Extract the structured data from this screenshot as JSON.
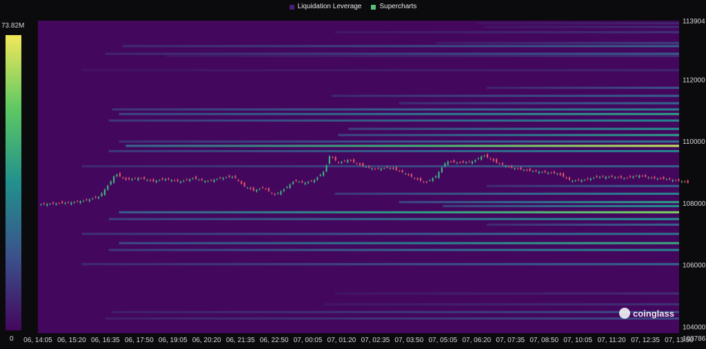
{
  "legend": {
    "items": [
      {
        "label": "Liquidation Leverage",
        "color": "#4a1f7a"
      },
      {
        "label": "Supercharts",
        "color": "#56c17a"
      }
    ]
  },
  "colorbar": {
    "max_label": "73.82M",
    "min_label": "0"
  },
  "watermark": "coinglass",
  "chart_data": {
    "type": "heatmap",
    "title": "",
    "xlabel": "",
    "ylabel": "",
    "ylim": [
      103786,
      113904
    ],
    "x_ticks": [
      "06, 14:05",
      "06, 15:20",
      "06, 16:35",
      "06, 17:50",
      "06, 19:05",
      "06, 20:20",
      "06, 21:35",
      "06, 22:50",
      "07, 00:05",
      "07, 01:20",
      "07, 02:35",
      "07, 03:50",
      "07, 05:05",
      "07, 06:20",
      "07, 07:35",
      "07, 08:50",
      "07, 10:05",
      "07, 11:20",
      "07, 12:35",
      "07, 13:50"
    ],
    "y_ticks": [
      113904,
      112000,
      110000,
      108000,
      106000,
      104000,
      103786
    ],
    "colorscale": {
      "min": 0,
      "max": 73.82,
      "unit": "M",
      "colors": [
        "#44075e",
        "#3b528b",
        "#21908d",
        "#5dc863",
        "#f2e85a"
      ]
    },
    "background_color": "#44075e",
    "liquidation_levels": [
      {
        "price": 113820,
        "start": 13.0,
        "intensity": 0.1
      },
      {
        "price": 113700,
        "start": 13.2,
        "intensity": 0.12
      },
      {
        "price": 113530,
        "start": 8.8,
        "intensity": 0.14
      },
      {
        "price": 113180,
        "start": 11.8,
        "intensity": 0.18
      },
      {
        "price": 113080,
        "start": 2.5,
        "intensity": 0.3
      },
      {
        "price": 112830,
        "start": 2.0,
        "intensity": 0.28
      },
      {
        "price": 112760,
        "start": 3.8,
        "intensity": 0.12
      },
      {
        "price": 112300,
        "start": 1.3,
        "intensity": 0.1
      },
      {
        "price": 111730,
        "start": 13.3,
        "intensity": 0.25
      },
      {
        "price": 111470,
        "start": 8.7,
        "intensity": 0.3
      },
      {
        "price": 111230,
        "start": 10.7,
        "intensity": 0.32
      },
      {
        "price": 111030,
        "start": 2.2,
        "intensity": 0.42
      },
      {
        "price": 110880,
        "start": 2.4,
        "intensity": 0.55
      },
      {
        "price": 110670,
        "start": 2.1,
        "intensity": 0.45
      },
      {
        "price": 110400,
        "start": 9.2,
        "intensity": 0.5
      },
      {
        "price": 110200,
        "start": 8.9,
        "intensity": 0.55
      },
      {
        "price": 109990,
        "start": 2.4,
        "intensity": 0.38
      },
      {
        "price": 109850,
        "start": 2.6,
        "intensity": 0.92
      },
      {
        "price": 109680,
        "start": 2.1,
        "intensity": 0.45
      },
      {
        "price": 109190,
        "start": 1.3,
        "intensity": 0.3
      },
      {
        "price": 108550,
        "start": 13.3,
        "intensity": 0.32
      },
      {
        "price": 108300,
        "start": 8.8,
        "intensity": 0.45
      },
      {
        "price": 108030,
        "start": 10.7,
        "intensity": 0.55
      },
      {
        "price": 107900,
        "start": 12.0,
        "intensity": 0.5
      },
      {
        "price": 107700,
        "start": 2.4,
        "intensity": 0.8
      },
      {
        "price": 107480,
        "start": 2.1,
        "intensity": 0.5
      },
      {
        "price": 107300,
        "start": 13.3,
        "intensity": 0.32
      },
      {
        "price": 107000,
        "start": 1.3,
        "intensity": 0.38
      },
      {
        "price": 106700,
        "start": 2.4,
        "intensity": 0.6
      },
      {
        "price": 106480,
        "start": 2.1,
        "intensity": 0.45
      },
      {
        "price": 106020,
        "start": 1.3,
        "intensity": 0.32
      },
      {
        "price": 105070,
        "start": 8.8,
        "intensity": 0.12
      },
      {
        "price": 104720,
        "start": 8.5,
        "intensity": 0.14
      },
      {
        "price": 104470,
        "start": 2.2,
        "intensity": 0.22
      },
      {
        "price": 104260,
        "start": 2.0,
        "intensity": 0.22
      }
    ],
    "price_series": [
      {
        "t": 0.0,
        "p": 107950
      },
      {
        "t": 0.5,
        "p": 107980
      },
      {
        "t": 1.0,
        "p": 108020
      },
      {
        "t": 1.4,
        "p": 108080
      },
      {
        "t": 1.8,
        "p": 108200
      },
      {
        "t": 2.1,
        "p": 108600
      },
      {
        "t": 2.3,
        "p": 108950
      },
      {
        "t": 2.6,
        "p": 108750
      },
      {
        "t": 3.0,
        "p": 108820
      },
      {
        "t": 3.4,
        "p": 108700
      },
      {
        "t": 3.8,
        "p": 108780
      },
      {
        "t": 4.2,
        "p": 108690
      },
      {
        "t": 4.6,
        "p": 108800
      },
      {
        "t": 5.0,
        "p": 108700
      },
      {
        "t": 5.4,
        "p": 108800
      },
      {
        "t": 5.8,
        "p": 108860
      },
      {
        "t": 6.1,
        "p": 108550
      },
      {
        "t": 6.4,
        "p": 108400
      },
      {
        "t": 6.7,
        "p": 108500
      },
      {
        "t": 7.0,
        "p": 108250
      },
      {
        "t": 7.3,
        "p": 108450
      },
      {
        "t": 7.6,
        "p": 108720
      },
      {
        "t": 7.9,
        "p": 108650
      },
      {
        "t": 8.2,
        "p": 108750
      },
      {
        "t": 8.5,
        "p": 109050
      },
      {
        "t": 8.65,
        "p": 109550
      },
      {
        "t": 8.9,
        "p": 109300
      },
      {
        "t": 9.2,
        "p": 109400
      },
      {
        "t": 9.6,
        "p": 109200
      },
      {
        "t": 10.0,
        "p": 109100
      },
      {
        "t": 10.4,
        "p": 109150
      },
      {
        "t": 10.8,
        "p": 109000
      },
      {
        "t": 11.2,
        "p": 108780
      },
      {
        "t": 11.5,
        "p": 108650
      },
      {
        "t": 11.8,
        "p": 108880
      },
      {
        "t": 12.1,
        "p": 109350
      },
      {
        "t": 12.5,
        "p": 109300
      },
      {
        "t": 12.9,
        "p": 109350
      },
      {
        "t": 13.2,
        "p": 109550
      },
      {
        "t": 13.6,
        "p": 109300
      },
      {
        "t": 14.0,
        "p": 109150
      },
      {
        "t": 14.5,
        "p": 109050
      },
      {
        "t": 15.0,
        "p": 109000
      },
      {
        "t": 15.4,
        "p": 108950
      },
      {
        "t": 15.8,
        "p": 108720
      },
      {
        "t": 16.2,
        "p": 108750
      },
      {
        "t": 16.6,
        "p": 108850
      },
      {
        "t": 17.0,
        "p": 108850
      },
      {
        "t": 17.4,
        "p": 108800
      },
      {
        "t": 17.8,
        "p": 108900
      },
      {
        "t": 18.2,
        "p": 108800
      },
      {
        "t": 18.6,
        "p": 108780
      },
      {
        "t": 19.0,
        "p": 108720
      },
      {
        "t": 19.3,
        "p": 108650
      }
    ]
  }
}
